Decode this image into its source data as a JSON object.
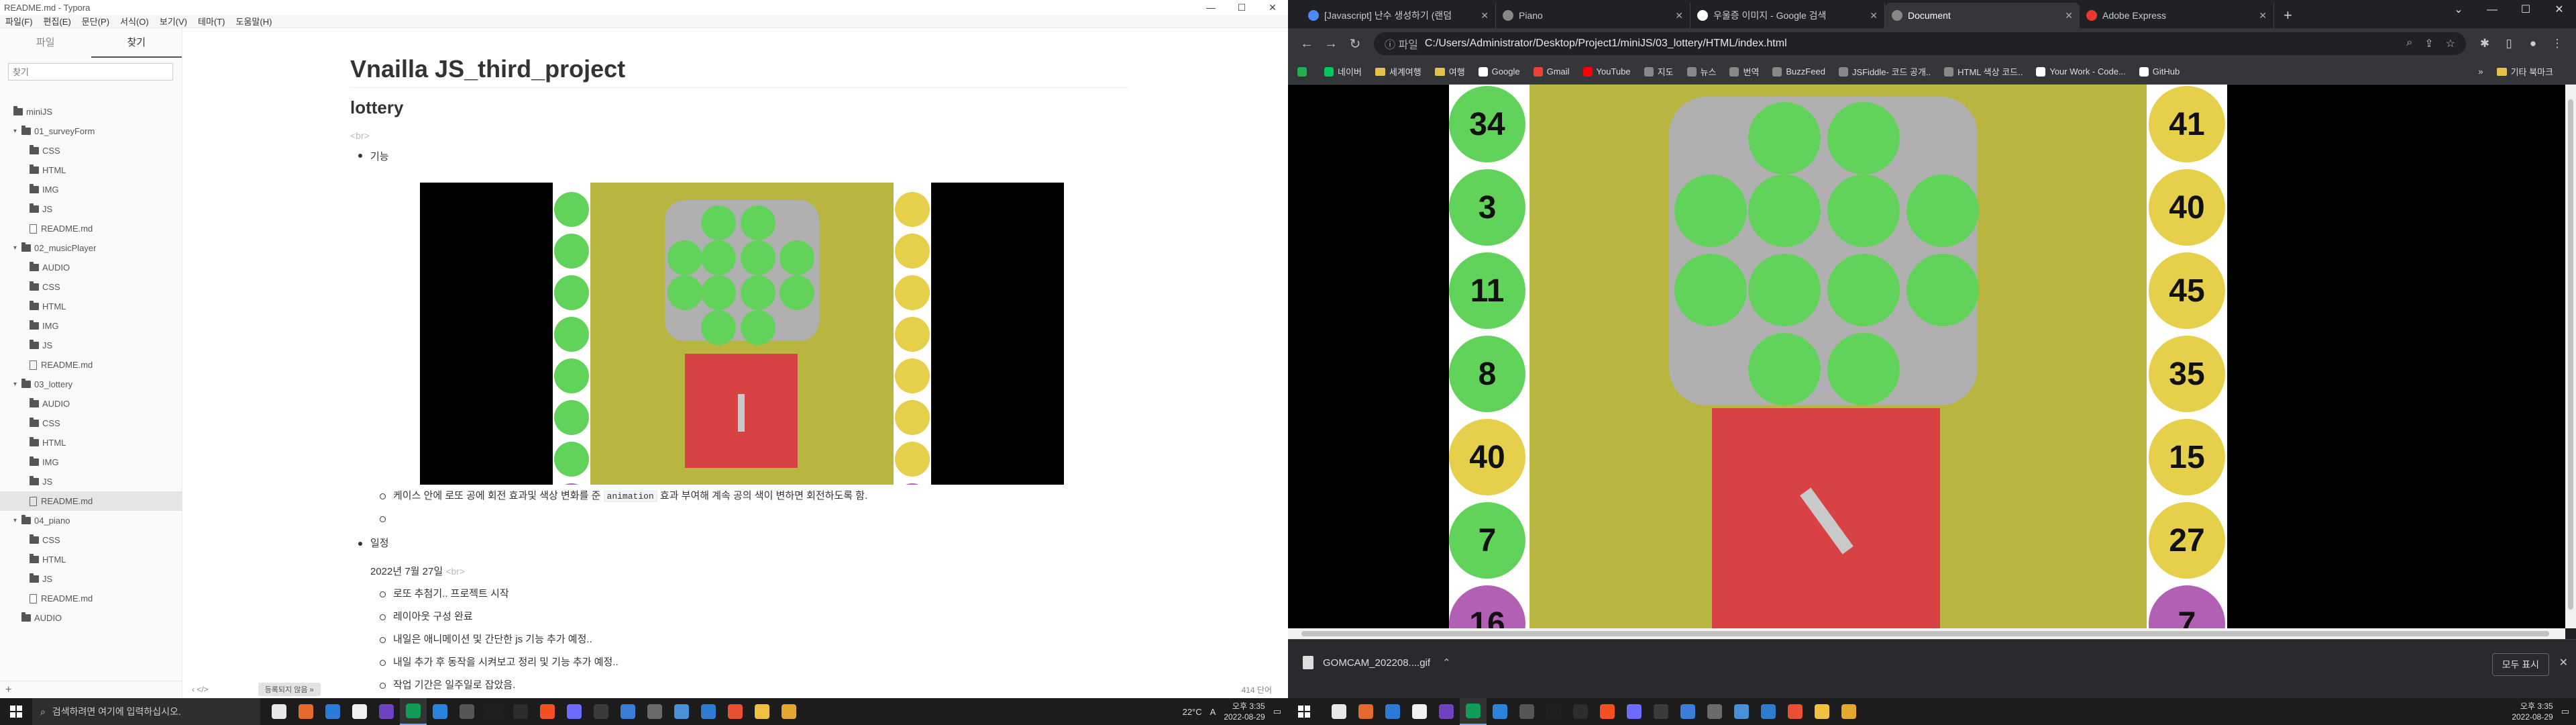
{
  "typora": {
    "title": "README.md - Typora",
    "menu": [
      "파일(F)",
      "편집(E)",
      "문단(P)",
      "서식(O)",
      "보기(V)",
      "테마(T)",
      "도움말(H)"
    ],
    "sidebar_tabs": [
      "파일",
      "찾기"
    ],
    "search_placeholder": "찾기",
    "tree": [
      {
        "label": "miniJS",
        "type": "folder",
        "depth": 0,
        "caret": "",
        "active": false
      },
      {
        "label": "01_surveyForm",
        "type": "folder",
        "depth": 1,
        "caret": "▾",
        "active": false
      },
      {
        "label": "CSS",
        "type": "folder",
        "depth": 2,
        "caret": "",
        "active": false
      },
      {
        "label": "HTML",
        "type": "folder",
        "depth": 2,
        "caret": "",
        "active": false
      },
      {
        "label": "IMG",
        "type": "folder",
        "depth": 2,
        "caret": "",
        "active": false
      },
      {
        "label": "JS",
        "type": "folder",
        "depth": 2,
        "caret": "",
        "active": false
      },
      {
        "label": "README.md",
        "type": "file",
        "depth": 2,
        "caret": "",
        "active": false
      },
      {
        "label": "02_musicPlayer",
        "type": "folder",
        "depth": 1,
        "caret": "▾",
        "active": false
      },
      {
        "label": "AUDIO",
        "type": "folder",
        "depth": 2,
        "caret": "",
        "active": false
      },
      {
        "label": "CSS",
        "type": "folder",
        "depth": 2,
        "caret": "",
        "active": false
      },
      {
        "label": "HTML",
        "type": "folder",
        "depth": 2,
        "caret": "",
        "active": false
      },
      {
        "label": "IMG",
        "type": "folder",
        "depth": 2,
        "caret": "",
        "active": false
      },
      {
        "label": "JS",
        "type": "folder",
        "depth": 2,
        "caret": "",
        "active": false
      },
      {
        "label": "README.md",
        "type": "file",
        "depth": 2,
        "caret": "",
        "active": false
      },
      {
        "label": "03_lottery",
        "type": "folder",
        "depth": 1,
        "caret": "▾",
        "active": false
      },
      {
        "label": "AUDIO",
        "type": "folder",
        "depth": 2,
        "caret": "",
        "active": false
      },
      {
        "label": "CSS",
        "type": "folder",
        "depth": 2,
        "caret": "",
        "active": false
      },
      {
        "label": "HTML",
        "type": "folder",
        "depth": 2,
        "caret": "",
        "active": false
      },
      {
        "label": "IMG",
        "type": "folder",
        "depth": 2,
        "caret": "",
        "active": false
      },
      {
        "label": "JS",
        "type": "folder",
        "depth": 2,
        "caret": "",
        "active": false
      },
      {
        "label": "README.md",
        "type": "file",
        "depth": 2,
        "caret": "",
        "active": true
      },
      {
        "label": "04_piano",
        "type": "folder",
        "depth": 1,
        "caret": "▾",
        "active": false
      },
      {
        "label": "CSS",
        "type": "folder",
        "depth": 2,
        "caret": "",
        "active": false
      },
      {
        "label": "HTML",
        "type": "folder",
        "depth": 2,
        "caret": "",
        "active": false
      },
      {
        "label": "JS",
        "type": "folder",
        "depth": 2,
        "caret": "",
        "active": false
      },
      {
        "label": "README.md",
        "type": "file",
        "depth": 2,
        "caret": "",
        "active": false
      },
      {
        "label": "AUDIO",
        "type": "folder",
        "depth": 1,
        "caret": "",
        "active": false
      }
    ],
    "sidebar_add": "+",
    "doc": {
      "h1": "Vnailla JS_third_project",
      "h2": "lottery",
      "br": "<br>",
      "bullet_feature": "기능",
      "desc_before": "케이스 안에 로또 공에 회전 효과및 색상 변화를 준 ",
      "desc_code": "animation",
      "desc_after": " 효과 부여해 계속 공의 색이 변하면 회전하도록 함.",
      "bullet_schedule": "일정",
      "date": "2022년 7월 27일",
      "schedule": [
        "로또 추첨기.. 프로젝트 시작",
        "레이아웃 구성 완료",
        "내일은 애니메이션 및 간단한 js 기능 추가 예정..",
        "내일 추가 후 동작을 시켜보고 정리 및 기능 추가 예정..",
        "작업 기간은 일주일로 잡았음."
      ]
    },
    "status_button": "등록되지 않음 »",
    "word_count": "414 단어",
    "status_icons": "‹  </>"
  },
  "chrome": {
    "tabs": [
      {
        "label": "[Javascript] 난수 생성하기 (랜덤",
        "active": false,
        "color": "#4c8bf5"
      },
      {
        "label": "Piano",
        "active": false,
        "color": "#888888"
      },
      {
        "label": "우울증 이미지 - Google 검색",
        "active": false,
        "color": "#ffffff"
      },
      {
        "label": "Document",
        "active": true,
        "color": "#888888"
      },
      {
        "label": "Adobe Express",
        "active": false,
        "color": "#e8392d"
      }
    ],
    "url_scheme": "ⓘ 파일",
    "url": "C:/Users/Administrator/Desktop/Project1/miniJS/03_lottery/HTML/index.html",
    "bookmarks": [
      {
        "label": "네이버",
        "color": "#03c75a"
      },
      {
        "label": "세계여행",
        "color": "folder"
      },
      {
        "label": "여행",
        "color": "folder"
      },
      {
        "label": "Google",
        "color": "#ffffff"
      },
      {
        "label": "Gmail",
        "color": "#ea4335"
      },
      {
        "label": "YouTube",
        "color": "#ff0000"
      },
      {
        "label": "지도",
        "color": "#888888"
      },
      {
        "label": "뉴스",
        "color": "#888888"
      },
      {
        "label": "번역",
        "color": "#888888"
      },
      {
        "label": "BuzzFeed",
        "color": "#888888"
      },
      {
        "label": "JSFiddle- 코드 공개..",
        "color": "#888888"
      },
      {
        "label": "HTML 색상 코드..",
        "color": "#888888"
      },
      {
        "label": "Your Work - Code...",
        "color": "#ffffff"
      },
      {
        "label": "GitHub",
        "color": "#ffffff"
      }
    ],
    "bookmarks_more": "»",
    "other_bookmarks": "기타 북마크",
    "download": {
      "file": "GOMCAM_202208....gif",
      "show_all": "모두 표시",
      "close": "✕"
    }
  },
  "lottery": {
    "left_balls": [
      "34",
      "3",
      "11",
      "8",
      "40",
      "7",
      "16"
    ],
    "left_colors": [
      "g",
      "g",
      "g",
      "g",
      "y",
      "g",
      "p"
    ],
    "right_balls": [
      "41",
      "40",
      "45",
      "35",
      "15",
      "27",
      "7"
    ],
    "right_colors": [
      "y",
      "y",
      "y",
      "y",
      "y",
      "y",
      "p"
    ],
    "gif_left_colors": [
      "g",
      "g",
      "g",
      "g",
      "g",
      "g",
      "g",
      "p"
    ],
    "gif_right_colors": [
      "y",
      "y",
      "y",
      "y",
      "y",
      "y",
      "y",
      "p"
    ]
  },
  "taskbar": {
    "search_placeholder": "검색하려면 여기에 입력하십시오.",
    "weather": "22°C",
    "time": "오후 3:35",
    "date": "2022-08-29",
    "lang": "A"
  }
}
